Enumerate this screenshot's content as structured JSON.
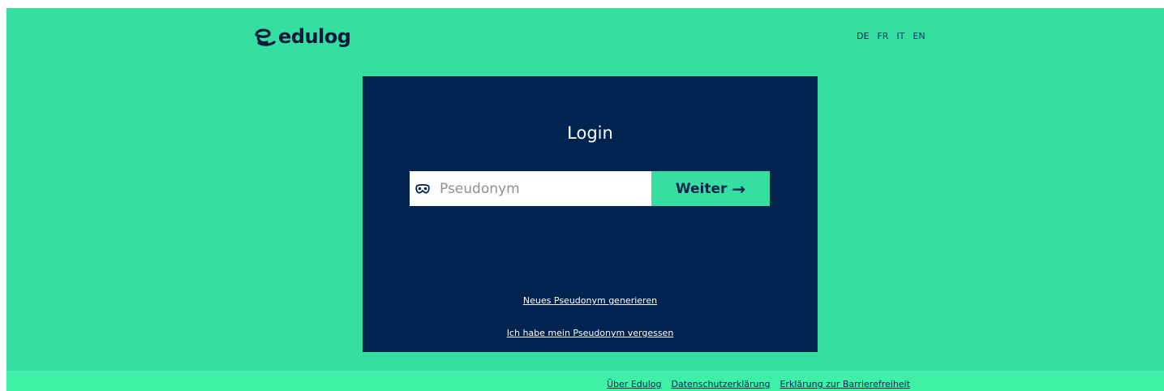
{
  "brand": {
    "name": "edulog",
    "colors": {
      "background": "#36dea2",
      "card": "#002350",
      "accent": "#36dea2",
      "footer": "#3ff0a7"
    }
  },
  "languages": [
    {
      "code": "DE",
      "active": true
    },
    {
      "code": "FR",
      "active": false
    },
    {
      "code": "IT",
      "active": false
    },
    {
      "code": "EN",
      "active": false
    }
  ],
  "login": {
    "title": "Login",
    "input": {
      "placeholder": "Pseudonym",
      "value": "",
      "icon": "mask-icon"
    },
    "submit_label": "Weiter",
    "submit_icon": "arrow-right-icon",
    "links": {
      "generate": "Neues Pseudonym generieren",
      "forgot": "Ich habe mein Pseudonym vergessen"
    }
  },
  "footer": {
    "links": [
      "Über Edulog",
      "Datenschutzerklärung",
      "Erklärung zur Barrierefreiheit"
    ]
  }
}
